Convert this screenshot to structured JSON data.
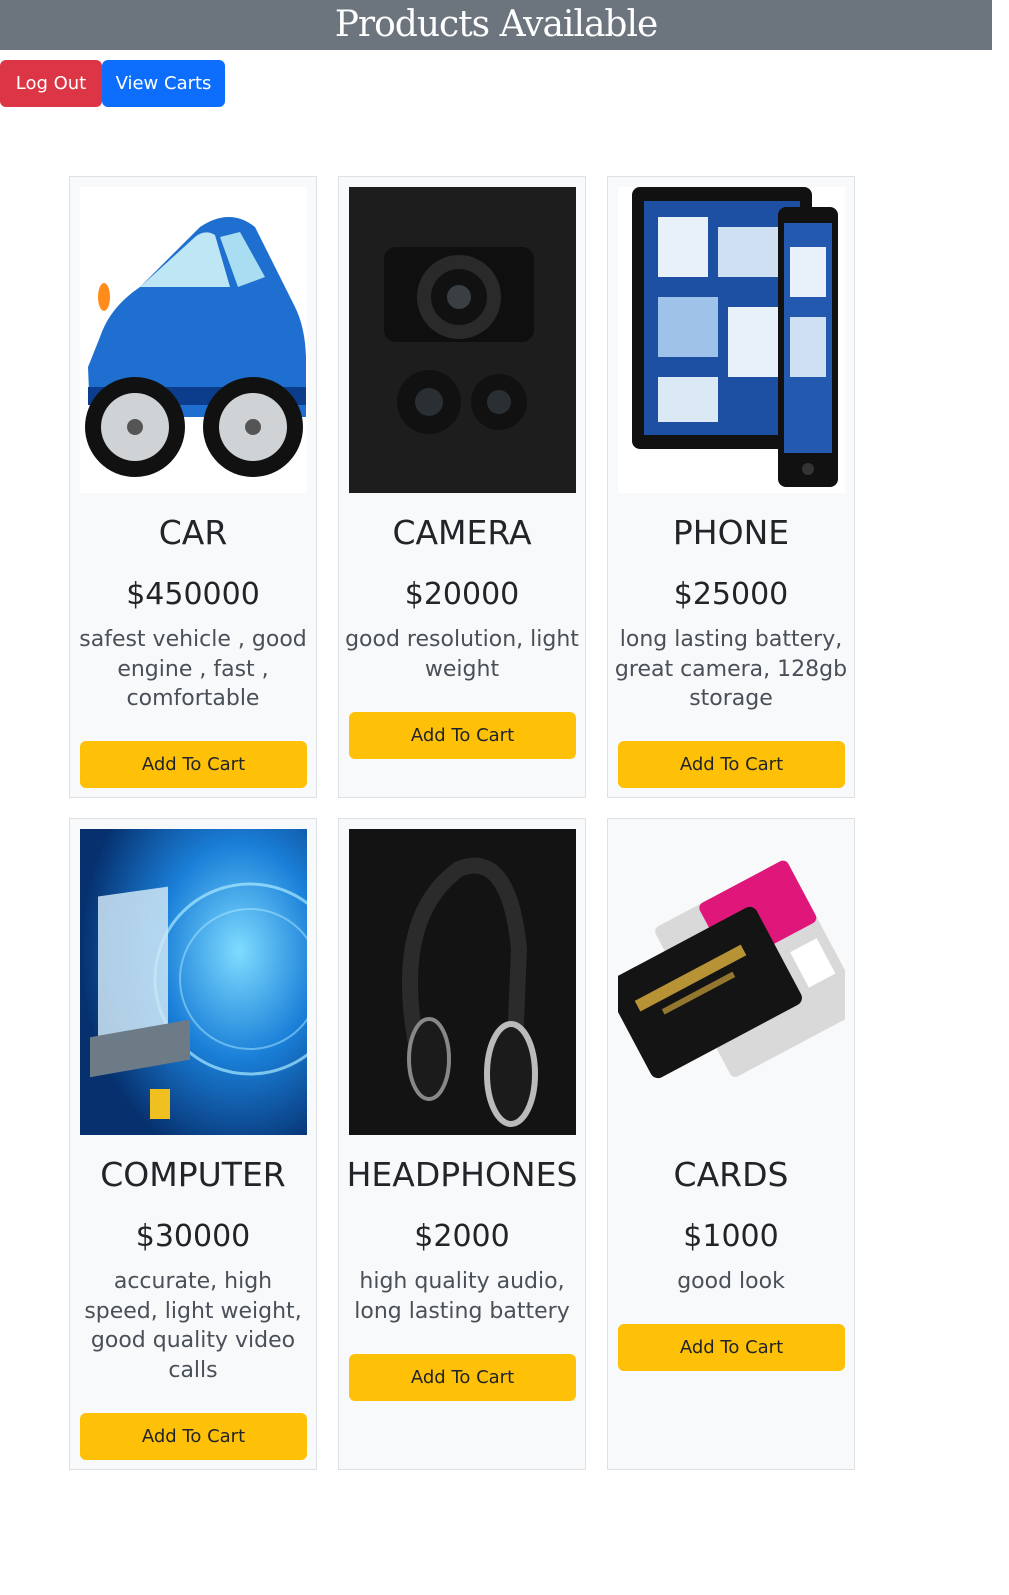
{
  "header": {
    "title": "Products Available"
  },
  "actions": {
    "logout_label": "Log Out",
    "view_carts_label": "View Carts"
  },
  "products": [
    {
      "name": "CAR",
      "price": "$450000",
      "description": "safest vehicle , good engine , fast , comfortable",
      "button": "Add To Cart",
      "image": "car-image"
    },
    {
      "name": "CAMERA",
      "price": "$20000",
      "description": "good resolution, light weight",
      "button": "Add To Cart",
      "image": "camera-image"
    },
    {
      "name": "PHONE",
      "price": "$25000",
      "description": "long lasting battery, great camera, 128gb storage",
      "button": "Add To Cart",
      "image": "phone-image"
    },
    {
      "name": "COMPUTER",
      "price": "$30000",
      "description": "accurate, high speed, light weight, good quality video calls",
      "button": "Add To Cart",
      "image": "computer-image"
    },
    {
      "name": "HEADPHONES",
      "price": "$2000",
      "description": "high quality audio, long lasting battery",
      "button": "Add To Cart",
      "image": "headphones-image"
    },
    {
      "name": "CARDS",
      "price": "$1000",
      "description": "good look",
      "button": "Add To Cart",
      "image": "cards-image"
    }
  ],
  "colors": {
    "header": "#6c757d",
    "danger": "#dc3545",
    "primary": "#0d6efd",
    "warning": "#ffc107"
  }
}
